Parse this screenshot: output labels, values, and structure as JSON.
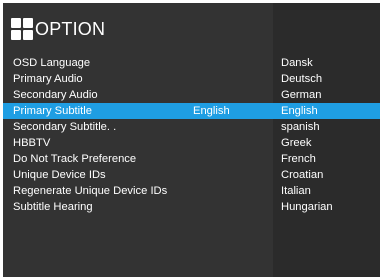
{
  "colors": {
    "background": "#333333",
    "right_panel": "#2b2b2b",
    "highlight": "#1f9ee3",
    "text": "#ffffff"
  },
  "header": {
    "icon": "four-squares-icon",
    "title": "OPTION"
  },
  "menu": {
    "items": [
      {
        "label": "OSD Language",
        "value": ""
      },
      {
        "label": "Primary Audio",
        "value": ""
      },
      {
        "label": "Secondary Audio",
        "value": ""
      },
      {
        "label": "Primary Subtitle",
        "value": "English"
      },
      {
        "label": "Secondary Subtitle. .",
        "value": ""
      },
      {
        "label": "HBBTV",
        "value": ""
      },
      {
        "label": "Do Not Track Preference",
        "value": ""
      },
      {
        "label": "Unique Device IDs",
        "value": ""
      },
      {
        "label": "Regenerate Unique Device IDs",
        "value": ""
      },
      {
        "label": "Subtitle Hearing",
        "value": ""
      }
    ]
  },
  "options": {
    "items": [
      "Dansk",
      "Deutsch",
      "German",
      "English",
      "spanish",
      "Greek",
      "French",
      "Croatian",
      "Italian",
      "Hungarian"
    ]
  }
}
